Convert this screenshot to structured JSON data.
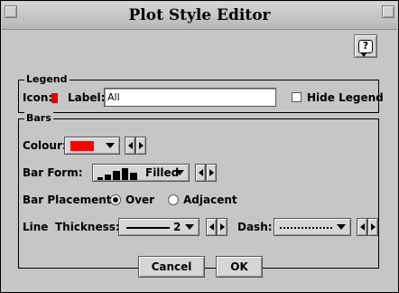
{
  "window": {
    "title": "Plot Style Editor"
  },
  "help": {
    "icon": "help-icon",
    "glyph": "?"
  },
  "legend": {
    "group_label": "Legend",
    "icon_label": "Icon:",
    "icon_color": "#e00000",
    "label_label": "Label:",
    "label_value": "All",
    "hide_label": "Hide Legend",
    "hide_checked": false
  },
  "bars": {
    "group_label": "Bars",
    "colour_label": "Colour:",
    "colour_value": "#ff0000",
    "form_label": "Bar Form:",
    "form_value": "Filled",
    "placement_label": "Bar Placement:",
    "placement_options": [
      "Over",
      "Adjacent"
    ],
    "placement_selected": "Over",
    "line_label": "Line",
    "thickness_label": "Thickness:",
    "thickness_value": "2",
    "dash_label": "Dash:"
  },
  "buttons": {
    "cancel": "Cancel",
    "ok": "OK"
  }
}
